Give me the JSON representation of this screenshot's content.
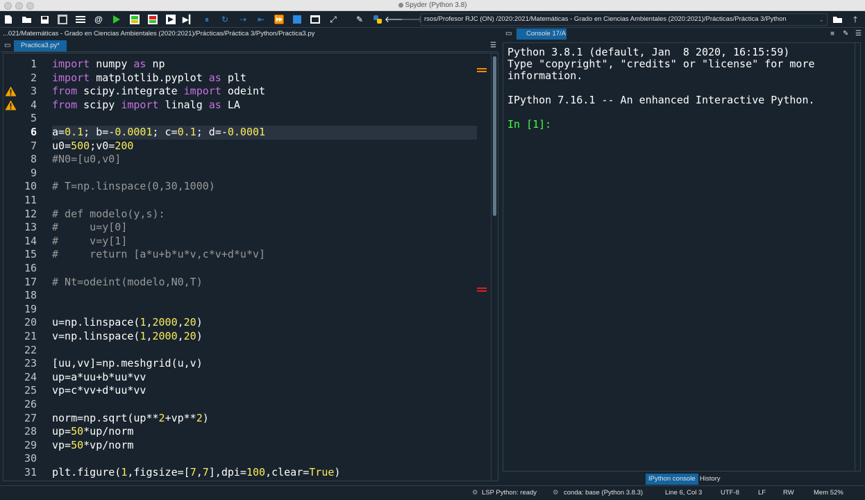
{
  "window": {
    "title": "Spyder (Python 3.8)"
  },
  "toolbar": {
    "path": "rsos/Profesor RJC (ON) /2020:2021/Matemáticas - Grado en Ciencias Ambientales (2020:2021)/Prácticas/Práctica 3/Python",
    "icons": [
      "new-file",
      "open-file",
      "save",
      "save-all",
      "outline",
      "at-sign",
      "run",
      "run-cell",
      "run-cell-advance",
      "run-selection",
      "debug",
      "step",
      "step-into",
      "step-out",
      "continue",
      "stop",
      "maximize",
      "fullscreen",
      "preferences",
      "python-path",
      "back",
      "forward",
      "browse",
      "up"
    ]
  },
  "editor": {
    "path": "...021/Matemáticas - Grado en Ciencias Ambientales (2020:2021)/Prácticas/Práctica 3/Python/Practica3.py",
    "tab_label": "Practica3.py*",
    "current_line": 6,
    "warning_lines": [
      3,
      4
    ],
    "lines": [
      "<span class=\"kw\">import</span> numpy <span class=\"kw\">as</span> np",
      "<span class=\"kw\">import</span> matplotlib.pyplot <span class=\"kw\">as</span> plt",
      "<span class=\"kw\">from</span> scipy.integrate <span class=\"kw\">import</span> odeint",
      "<span class=\"kw\">from</span> scipy <span class=\"kw\">import</span> linalg <span class=\"kw\">as</span> LA",
      "",
      "a=<span class=\"num\">0.1</span>; b=-<span class=\"num\">0.0001</span>; c=<span class=\"num\">0.1</span>; d=-<span class=\"num\">0.0001</span>",
      "u0=<span class=\"num\">500</span>;v0=<span class=\"num\">200</span>",
      "<span class=\"cm\">#N0=[u0,v0]</span>",
      "",
      "<span class=\"cm\"># T=np.linspace(0,30,1000)</span>",
      "",
      "<span class=\"cm\"># def modelo(y,s):</span>",
      "<span class=\"cm\">#     u=y[0]</span>",
      "<span class=\"cm\">#     v=y[1]</span>",
      "<span class=\"cm\">#     return [a*u+b*u*v,c*v+d*u*v]</span>",
      "",
      "<span class=\"cm\"># Nt=odeint(modelo,N0,T)</span>",
      "",
      "",
      "u=np.linspace(<span class=\"num\">1</span>,<span class=\"num\">2000</span>,<span class=\"num\">20</span>)",
      "v=np.linspace(<span class=\"num\">1</span>,<span class=\"num\">2000</span>,<span class=\"num\">20</span>)",
      "",
      "[uu,vv]=np.meshgrid(u,v)",
      "up=a*uu+b*uu*vv",
      "vp=c*vv+d*uu*vv",
      "",
      "norm=np.sqrt(up**<span class=\"num\">2</span>+vp**<span class=\"num\">2</span>)",
      "up=<span class=\"num\">50</span>*up/norm",
      "vp=<span class=\"num\">50</span>*vp/norm",
      "",
      "plt.figure(<span class=\"num\">1</span>,figsize=[<span class=\"num\">7</span>,<span class=\"num\">7</span>],dpi=<span class=\"num\">100</span>,clear=<span class=\"num\">True</span>)"
    ]
  },
  "console": {
    "tab_label": "Console 17/A",
    "lines": [
      "Python 3.8.1 (default, Jan  8 2020, 16:15:59)",
      "Type \"copyright\", \"credits\" or \"license\" for more",
      "information.",
      "",
      "IPython 7.16.1 -- An enhanced Interactive Python.",
      "",
      "In [1]:"
    ],
    "bottom_tabs": [
      "IPython console",
      "History"
    ]
  },
  "status": {
    "lsp": "LSP Python: ready",
    "conda": "conda: base (Python 3.8.3)",
    "position": "Line 6, Col 3",
    "encoding": "UTF-8",
    "eol": "LF",
    "mode": "RW",
    "memory": "Mem 52%"
  },
  "colors": {
    "background": "#19232d",
    "keyword": "#c670e0",
    "number": "#faed5c",
    "comment": "#999999",
    "prompt": "#43ff43",
    "accent": "#1464a0"
  }
}
